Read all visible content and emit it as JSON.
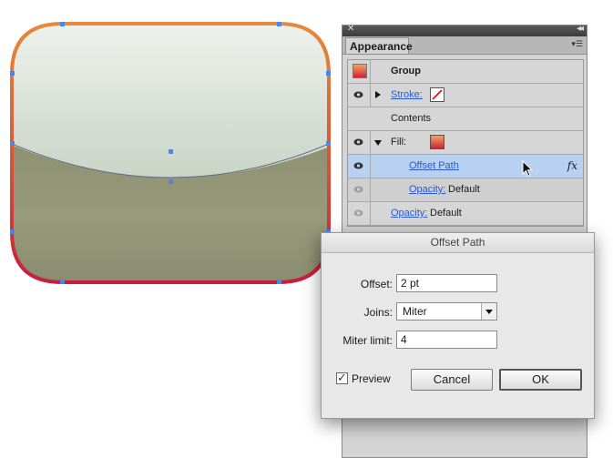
{
  "colors": {
    "stroke_top": "#e08a35",
    "stroke_bottom": "#c81d3e",
    "fill_top": "#eef1ec",
    "fill_mid": "#b8c8b4",
    "fill_bottom": "#8e8f72",
    "selection_handle": "#4a86f0",
    "selected_row": "#b9d1f1"
  },
  "panel": {
    "tab": "Appearance",
    "close_icon": "close-icon",
    "collapse_icon": "double-chevron-icon",
    "menu_icon": "panel-menu-icon",
    "rows": {
      "group": {
        "label": "Group"
      },
      "stroke": {
        "label": "Stroke:"
      },
      "contents": {
        "label": "Contents"
      },
      "fill": {
        "label": "Fill:"
      },
      "offset_path": {
        "label": "Offset Path",
        "fx": "fx"
      },
      "fill_opacity": {
        "label": "Opacity:",
        "value": "Default"
      },
      "opacity": {
        "label": "Opacity:",
        "value": "Default"
      }
    }
  },
  "dialog": {
    "title": "Offset Path",
    "offset_label": "Offset:",
    "offset_value": "2 pt",
    "joins_label": "Joins:",
    "joins_value": "Miter",
    "miter_label": "Miter limit:",
    "miter_value": "4",
    "preview_label": "Preview",
    "preview_checked": true,
    "cancel_label": "Cancel",
    "ok_label": "OK"
  }
}
